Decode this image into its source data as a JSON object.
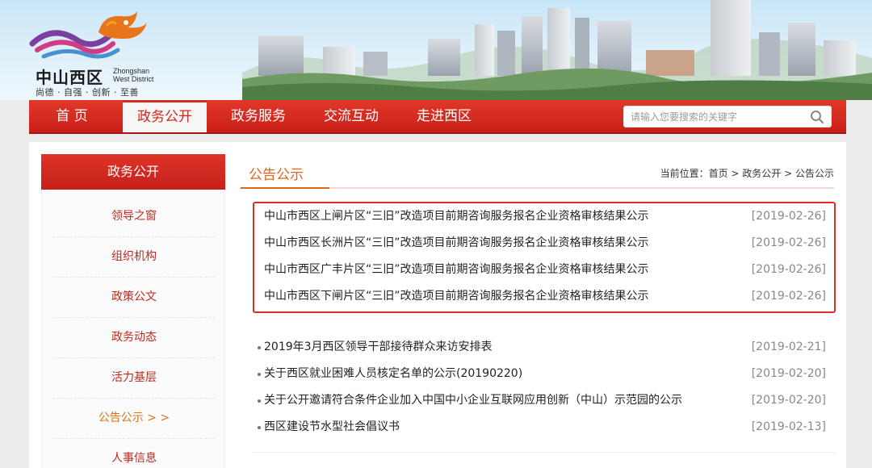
{
  "logo": {
    "cn": "中山西区",
    "en_line1": "Zhongshan",
    "en_line2": "West District",
    "slogan": "尚德 · 自强 · 创新 · 至善"
  },
  "nav": {
    "items": [
      {
        "label": "首  页",
        "active": false
      },
      {
        "label": "政务公开",
        "active": true
      },
      {
        "label": "政务服务",
        "active": false
      },
      {
        "label": "交流互动",
        "active": false
      },
      {
        "label": "走进西区",
        "active": false
      }
    ],
    "search_placeholder": "请输入您要搜索的关键字"
  },
  "sidebar": {
    "title": "政务公开",
    "items": [
      {
        "label": "领导之窗"
      },
      {
        "label": "组织机构"
      },
      {
        "label": "政策公文"
      },
      {
        "label": "政务动态"
      },
      {
        "label": "活力基层"
      },
      {
        "label": "公告公示 > >"
      },
      {
        "label": "人事信息"
      }
    ]
  },
  "main": {
    "title": "公告公示",
    "breadcrumb": {
      "prefix": "当前位置：",
      "home": "首页",
      "level1": "政务公开",
      "level2": "公告公示",
      "sep": " > "
    },
    "highlighted_items": [
      {
        "title": "中山市西区上闸片区“三旧”改造项目前期咨询服务报名企业资格审核结果公示",
        "date": "[2019-02-26]"
      },
      {
        "title": "中山市西区长洲片区“三旧”改造项目前期咨询服务报名企业资格审核结果公示",
        "date": "[2019-02-26]"
      },
      {
        "title": "中山市西区广丰片区“三旧”改造项目前期咨询服务报名企业资格审核结果公示",
        "date": "[2019-02-26]"
      },
      {
        "title": "中山市西区下闸片区“三旧”改造项目前期咨询服务报名企业资格审核结果公示",
        "date": "[2019-02-26]"
      }
    ],
    "items": [
      {
        "title": "2019年3月西区领导干部接待群众来访安排表",
        "date": "[2019-02-21]"
      },
      {
        "title": "关于西区就业困难人员核定名单的公示(20190220)",
        "date": "[2019-02-20]"
      },
      {
        "title": "关于公开邀请符合条件企业加入中国中小企业互联网应用创新（中山）示范园的公示",
        "date": "[2019-02-20]"
      },
      {
        "title": "西区建设节水型社会倡议书",
        "date": "[2019-02-13]"
      }
    ]
  },
  "colors": {
    "brand_red": "#d2291f",
    "accent_orange": "#e0641b",
    "highlight_border": "#e02a23"
  }
}
